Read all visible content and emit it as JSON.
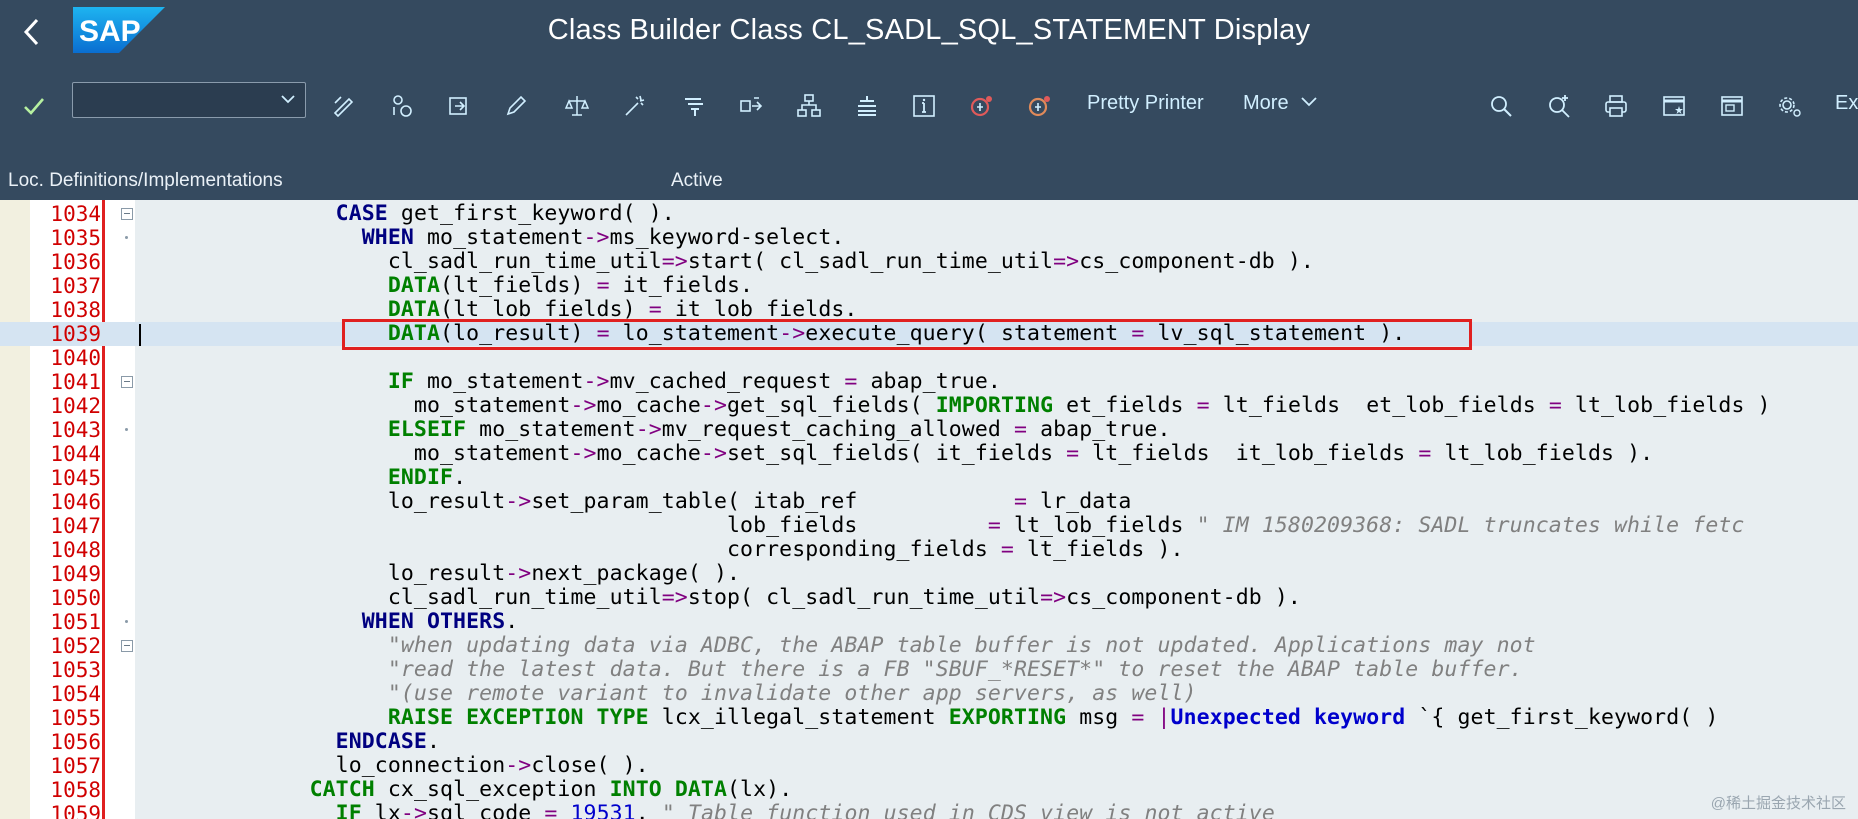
{
  "window": {
    "title": "Class Builder Class CL_SADL_SQL_STATEMENT Display",
    "logo": "SAP"
  },
  "toolbar": {
    "command_field_value": "",
    "pretty_printer_label": "Pretty Printer",
    "more_label": "More",
    "exit_label": "Ex",
    "icons": [
      "check-icon",
      "display-change-icon",
      "other-object-icon",
      "activate-icon",
      "edit-icon",
      "check-syntax-icon",
      "magic-wand-icon",
      "where-used-icon",
      "navigate-icon",
      "hierarchy-icon",
      "stack-icon",
      "info-icon",
      "breakpoint-icon",
      "session-breakpoint-icon",
      "search-icon",
      "search-next-icon",
      "print-icon",
      "create-session-icon",
      "window-icon",
      "settings-icon"
    ]
  },
  "infobar": {
    "left_label": "Loc. Definitions/Implementations",
    "status_label": "Active"
  },
  "editor": {
    "highlighted_line": "1039",
    "lines": [
      {
        "n": "1034"
      },
      {
        "n": "1035"
      },
      {
        "n": "1036"
      },
      {
        "n": "1037"
      },
      {
        "n": "1038"
      },
      {
        "n": "1039"
      },
      {
        "n": "1040"
      },
      {
        "n": "1041"
      },
      {
        "n": "1042"
      },
      {
        "n": "1043"
      },
      {
        "n": "1044"
      },
      {
        "n": "1045"
      },
      {
        "n": "1046"
      },
      {
        "n": "1047"
      },
      {
        "n": "1048"
      },
      {
        "n": "1049"
      },
      {
        "n": "1050"
      },
      {
        "n": "1051"
      },
      {
        "n": "1052"
      },
      {
        "n": "1053"
      },
      {
        "n": "1054"
      },
      {
        "n": "1055"
      },
      {
        "n": "1056"
      },
      {
        "n": "1057"
      },
      {
        "n": "1058"
      },
      {
        "n": "1059"
      }
    ]
  },
  "watermark": "@稀土掘金技术社区",
  "colors": {
    "shell": "#354a5f",
    "editor_bg": "#e8eef1",
    "line_number": "#d00000",
    "keyword": "#008000",
    "highlight_border": "#e02020",
    "toolbar_text": "#d1efff"
  }
}
